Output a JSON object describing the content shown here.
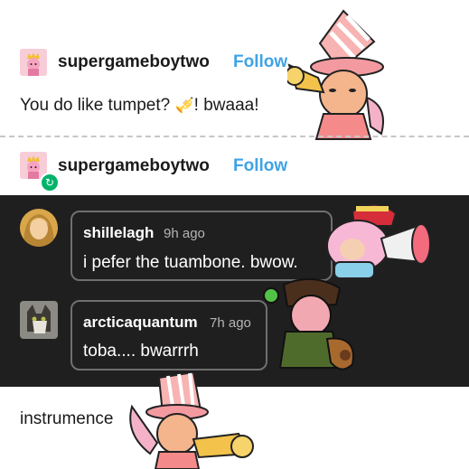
{
  "post1": {
    "username": "supergameboytwo",
    "follow_label": "Follow",
    "text": "You do like tumpet?",
    "emoji": "🎺",
    "text_after": "! bwaaa!"
  },
  "post2": {
    "username": "supergameboytwo",
    "follow_label": "Follow",
    "reblog_icon": "reblog-icon"
  },
  "comments": [
    {
      "username": "shillelagh",
      "time": "9h ago",
      "text": "i pefer the tuambone. bwow."
    },
    {
      "username": "arcticaquantum",
      "time": "7h ago",
      "text": "toba.... bwarrrh"
    }
  ],
  "footer": {
    "text": "instrumence"
  },
  "colors": {
    "follow": "#3fa3e6",
    "dark_panel": "#1f1f1f",
    "reblog": "#00b36b"
  }
}
